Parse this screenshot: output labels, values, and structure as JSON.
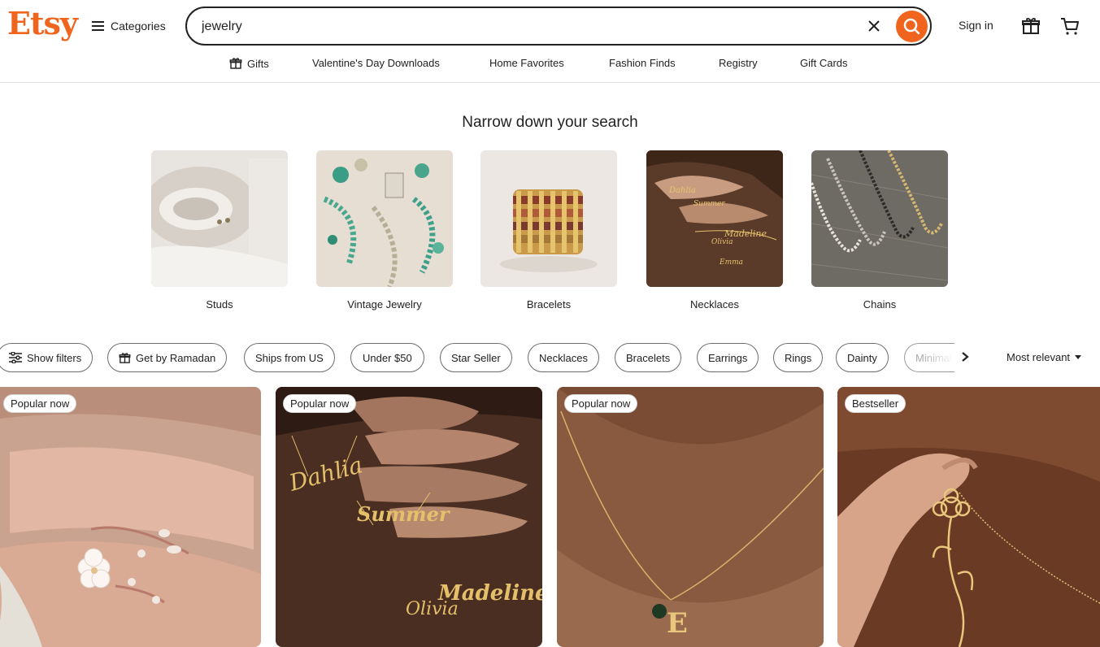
{
  "header": {
    "logo": "Etsy",
    "categories_label": "Categories",
    "search_value": "jewelry",
    "signin_label": "Sign in"
  },
  "nav": {
    "items": [
      "Gifts",
      "Valentine's Day Downloads",
      "Home Favorites",
      "Fashion Finds",
      "Registry",
      "Gift Cards"
    ]
  },
  "narrow": {
    "title": "Narrow down your search",
    "categories": [
      "Studs",
      "Vintage Jewelry",
      "Bracelets",
      "Necklaces",
      "Chains"
    ]
  },
  "filters": {
    "chips": [
      "Show filters",
      "Get by Ramadan",
      "Ships from US",
      "Under $50",
      "Star Seller",
      "Necklaces",
      "Bracelets",
      "Earrings",
      "Rings",
      "Dainty"
    ],
    "faded_chip": "Minimal",
    "sort_label": "Most relevant"
  },
  "listings": {
    "badges": [
      "Popular now",
      "Popular now",
      "Popular now",
      "Bestseller"
    ]
  },
  "colors": {
    "brand": "#f1641e",
    "text": "#222222"
  }
}
